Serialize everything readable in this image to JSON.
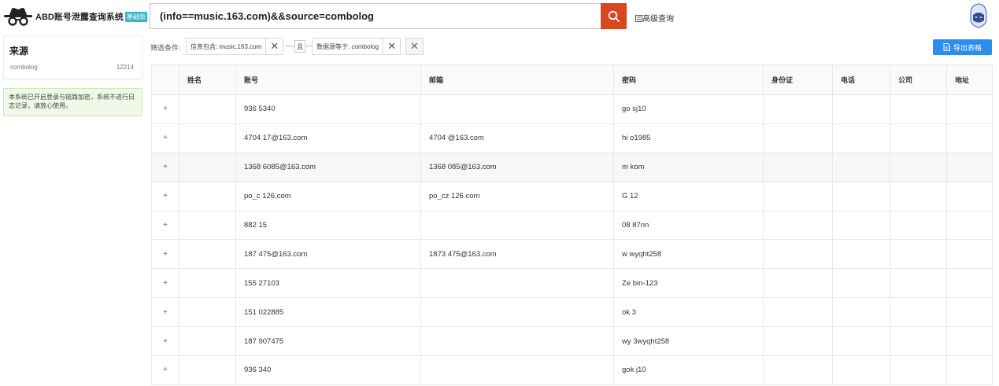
{
  "header": {
    "app_title": "ABD账号泄露查询系统",
    "edition_badge": "基础版",
    "search_query": "(info==music.163.com)&&source=combolog",
    "advanced_search": "高级查询"
  },
  "sidebar": {
    "source_title": "来源",
    "source_name": "combolog",
    "source_count": "12214",
    "notice": "本系统已开启登录与链路加密，系统不进行日志记录，请放心使用。"
  },
  "filters": {
    "label": "筛选条件:",
    "chip1": "信息包含: music.163.com",
    "operator": "且",
    "chip2": "数据源等于: combolog"
  },
  "toolbar": {
    "export_label": "导出表格"
  },
  "table": {
    "headers": [
      "",
      "姓名",
      "账号",
      "邮箱",
      "密码",
      "身份证",
      "电话",
      "公司",
      "地址"
    ],
    "rows": [
      {
        "expand": "+",
        "name": "",
        "account": "936    5340",
        "email": "",
        "password": "go     sj10"
      },
      {
        "expand": "+",
        "name": "",
        "account": "4704    17@163.com",
        "email": "4704    @163.com",
        "password": "hi      o1985"
      },
      {
        "expand": "+",
        "name": "",
        "account": "1368    6085@163.com",
        "email": "1368    085@163.com",
        "password": "m      kom"
      },
      {
        "expand": "+",
        "name": "",
        "account": "po_c     126.com",
        "email": "po_cz     126.com",
        "password": "G      12"
      },
      {
        "expand": "+",
        "name": "",
        "account": "882     15",
        "email": "",
        "password": "08      87nn"
      },
      {
        "expand": "+",
        "name": "",
        "account": "187     475@163.com",
        "email": "1873     475@163.com",
        "password": "w      wyqht258"
      },
      {
        "expand": "+",
        "name": "",
        "account": "155   27103",
        "email": "",
        "password": "Ze      bin-123"
      },
      {
        "expand": "+",
        "name": "",
        "account": "151   022885",
        "email": "",
        "password": "ok      3"
      },
      {
        "expand": "+",
        "name": "",
        "account": "187   907475",
        "email": "",
        "password": "wy      3wyqht258"
      },
      {
        "expand": "+",
        "name": "",
        "account": "936     340",
        "email": "",
        "password": "gok     j10"
      }
    ]
  },
  "colors": {
    "search_button": "#d9471f",
    "export_button": "#2c8df0",
    "badge": "#3bb4c6",
    "notice_bg": "#f0f9e8"
  },
  "icons": {
    "logo": "incognito-hat-glasses-icon",
    "search": "search-icon",
    "advanced": "filter-icon",
    "avatar": "hacker-avatar-icon",
    "export": "document-icon",
    "close": "close-icon"
  }
}
